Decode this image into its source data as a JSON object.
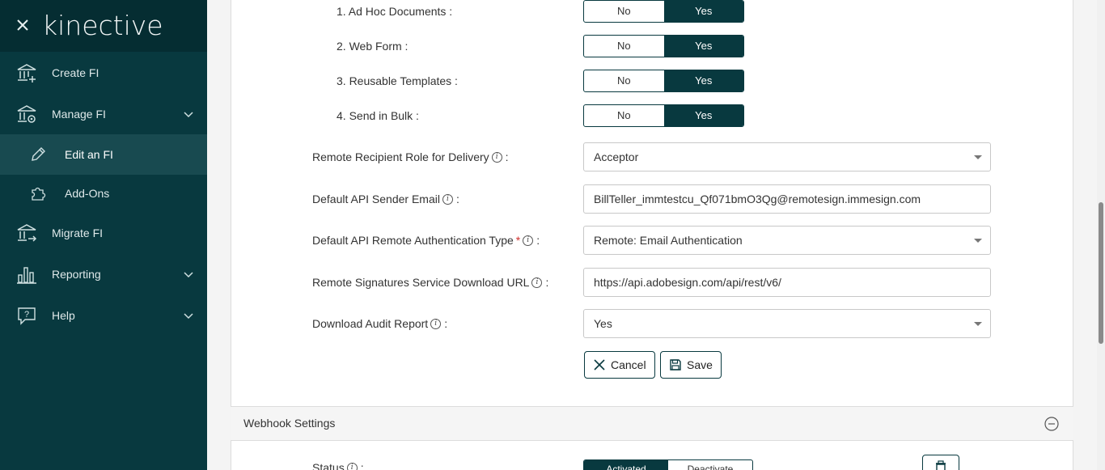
{
  "app": {
    "logo_text": "kinective"
  },
  "sidebar": {
    "items": [
      {
        "label": "Create FI",
        "icon": "bank-plus-icon"
      },
      {
        "label": "Manage FI",
        "icon": "bank-gear-icon",
        "expanded": true
      },
      {
        "label": "Edit an FI",
        "icon": "pencil-icon",
        "active": true
      },
      {
        "label": "Add-Ons",
        "icon": "puzzle-icon"
      },
      {
        "label": "Migrate FI",
        "icon": "bank-arrow-icon"
      },
      {
        "label": "Reporting",
        "icon": "bar-chart-icon"
      },
      {
        "label": "Help",
        "icon": "help-bubble-icon"
      }
    ]
  },
  "features": {
    "no_label": "No",
    "yes_label": "Yes",
    "items": [
      {
        "label": "1. Ad Hoc Documents :",
        "value": "Yes"
      },
      {
        "label": "2. Web Form :",
        "value": "Yes"
      },
      {
        "label": "3. Reusable Templates :",
        "value": "Yes"
      },
      {
        "label": "4. Send in Bulk :",
        "value": "Yes"
      }
    ]
  },
  "fields": {
    "recipient_role": {
      "label": "Remote Recipient Role for Delivery",
      "value": "Acceptor"
    },
    "sender_email": {
      "label": "Default API Sender Email",
      "value": "BillTeller_immtestcu_Qf071bmO3Qg@remotesign.immesign.com"
    },
    "auth_type": {
      "label": "Default API Remote Authentication Type",
      "value": "Remote: Email Authentication"
    },
    "download_url": {
      "label": "Remote Signatures Service Download URL",
      "value": "https://api.adobesign.com/api/rest/v6/"
    },
    "audit_report": {
      "label": "Download Audit Report",
      "value": "Yes"
    }
  },
  "actions": {
    "cancel_label": "Cancel",
    "save_label": "Save"
  },
  "webhook": {
    "title": "Webhook Settings",
    "status_label": "Status",
    "activated_label": "Activated",
    "deactivate_label": "Deactivate"
  },
  "colors": {
    "brand": "#08393f",
    "sidebar": "#08393f",
    "required": "#d0312d"
  }
}
